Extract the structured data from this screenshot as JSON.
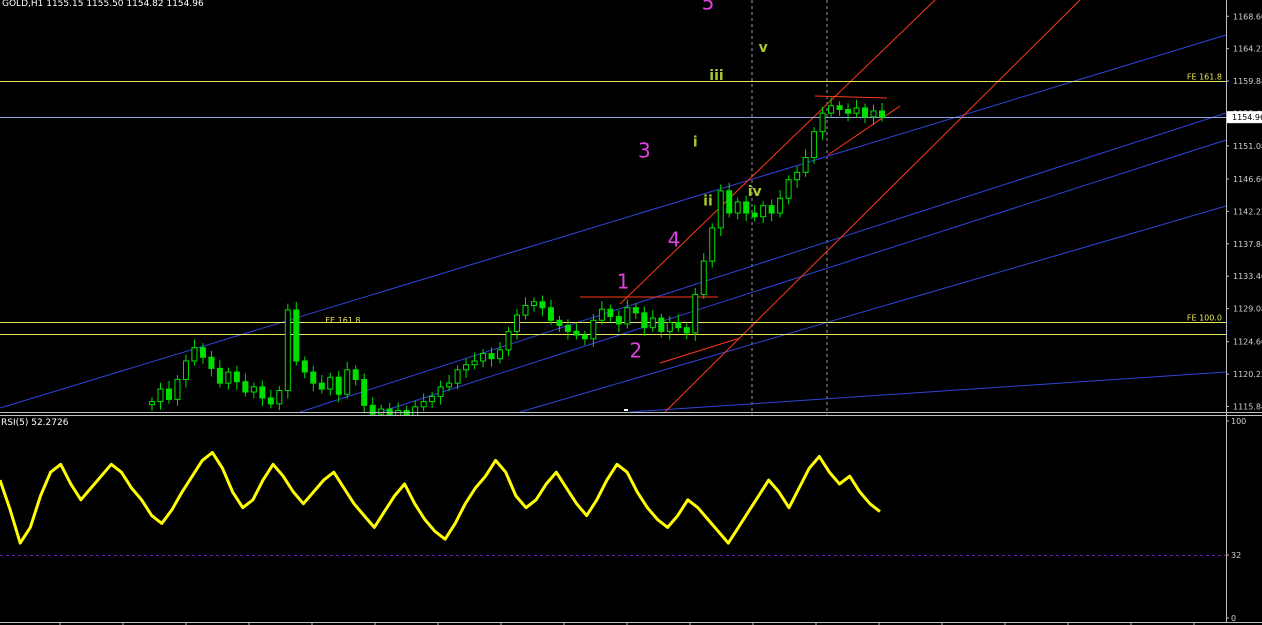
{
  "header": {
    "symbol": "GOLD,H1",
    "ohlc": "1155.15 1155.50 1154.82 1154.96"
  },
  "colors": {
    "background": "#000000",
    "frame": "#c0c0c0",
    "candle": "#00e000",
    "yellow_level": "#e8e85a",
    "blue_line": "#2f45d8",
    "red_line": "#ff3a1a",
    "wave_label": "#e040e0",
    "subwave_label": "#a8c830",
    "rsi": "#ffff00",
    "rsi_level": "#7a1fa8"
  },
  "chart_data": [
    {
      "type": "candlestick",
      "symbol": "GOLD",
      "timeframe": "H1",
      "last_ohlc": {
        "open": 1155.15,
        "high": 1155.5,
        "low": 1154.82,
        "close": 1154.96
      },
      "current_price": "1154.96",
      "ylim": [
        1115.1,
        1170.8
      ],
      "y_ticks": [
        "1168.60",
        "1164.22",
        "1159.84",
        "1155.46",
        "1151.08",
        "1146.60",
        "1142.22",
        "1137.84",
        "1133.46",
        "1129.08",
        "1124.60",
        "1120.22",
        "1115.84"
      ],
      "close_path": [
        1116.5,
        1118.2,
        1116.8,
        1119.5,
        1122.0,
        1123.8,
        1122.5,
        1121.0,
        1119.0,
        1120.5,
        1119.2,
        1117.8,
        1118.5,
        1117.0,
        1116.2,
        1118.0,
        1128.9,
        1122.0,
        1120.5,
        1119.0,
        1118.2,
        1119.8,
        1117.5,
        1120.8,
        1119.5,
        1116.0,
        1114.8,
        1115.5,
        1114.2,
        1115.3,
        1114.0,
        1115.8,
        1116.5,
        1117.2,
        1118.5,
        1119.0,
        1120.8,
        1121.5,
        1122.0,
        1123.0,
        1122.3,
        1123.5,
        1126.0,
        1128.2,
        1129.5,
        1130.0,
        1129.2,
        1127.5,
        1126.8,
        1126.0,
        1125.5,
        1125.0,
        1127.5,
        1129.0,
        1128.0,
        1127.0,
        1129.2,
        1128.5,
        1126.5,
        1127.8,
        1126.0,
        1127.2,
        1126.5,
        1125.8,
        1131.0,
        1135.5,
        1140.0,
        1145.0,
        1142.0,
        1143.5,
        1142.0,
        1141.5,
        1143.0,
        1142.0,
        1144.0,
        1146.5,
        1147.5,
        1149.5,
        1153.0,
        1155.5,
        1156.5,
        1156.0,
        1155.5,
        1156.2,
        1155.0,
        1155.8,
        1154.96
      ],
      "horizontal_levels": [
        {
          "label": "FE 161.8",
          "value": 1159.8
        },
        {
          "label": "",
          "value": 1154.96
        },
        {
          "label": "FE 100.0",
          "value": 1127.3
        },
        {
          "label": "",
          "value": 1125.6
        }
      ],
      "annotations": [
        {
          "text": "5",
          "role": "wave",
          "time_index": 65.5,
          "price": 1169.5
        },
        {
          "text": "v",
          "role": "subwave",
          "time_index": 72.0,
          "price": 1163.8
        },
        {
          "text": "iii",
          "role": "subwave",
          "time_index": 66.5,
          "price": 1160.0
        },
        {
          "text": "3",
          "role": "wave",
          "time_index": 58.0,
          "price": 1149.5
        },
        {
          "text": "i",
          "role": "subwave",
          "time_index": 64.0,
          "price": 1151.0
        },
        {
          "text": "ii",
          "role": "subwave",
          "time_index": 65.5,
          "price": 1143.0
        },
        {
          "text": "iv",
          "role": "subwave",
          "time_index": 71.0,
          "price": 1144.3
        },
        {
          "text": "4",
          "role": "wave",
          "time_index": 61.5,
          "price": 1137.5
        },
        {
          "text": "1",
          "role": "wave",
          "time_index": 55.5,
          "price": 1131.8
        },
        {
          "text": "2",
          "role": "wave",
          "time_index": 57.0,
          "price": 1122.5
        },
        {
          "text": "FE 161.8",
          "role": "level",
          "time_index": 22.5,
          "price": 1127.1
        }
      ]
    },
    {
      "type": "line",
      "name": "RSI(5) 52.2726",
      "ylim": [
        0,
        100
      ],
      "y_ticks": [
        "100",
        "32",
        "0"
      ],
      "levels": [
        32
      ],
      "values": [
        70,
        55,
        38,
        46,
        62,
        74,
        78,
        68,
        60,
        66,
        72,
        78,
        74,
        66,
        60,
        52,
        48,
        55,
        64,
        72,
        80,
        84,
        76,
        64,
        56,
        60,
        70,
        78,
        72,
        64,
        58,
        64,
        70,
        74,
        66,
        58,
        52,
        46,
        54,
        62,
        68,
        58,
        50,
        44,
        40,
        48,
        58,
        66,
        72,
        80,
        74,
        62,
        56,
        60,
        68,
        74,
        66,
        58,
        52,
        60,
        70,
        78,
        74,
        64,
        56,
        50,
        46,
        52,
        60,
        56,
        50,
        44,
        38,
        46,
        54,
        62,
        70,
        64,
        56,
        66,
        76,
        82,
        74,
        68,
        72,
        64,
        58,
        54
      ]
    }
  ]
}
